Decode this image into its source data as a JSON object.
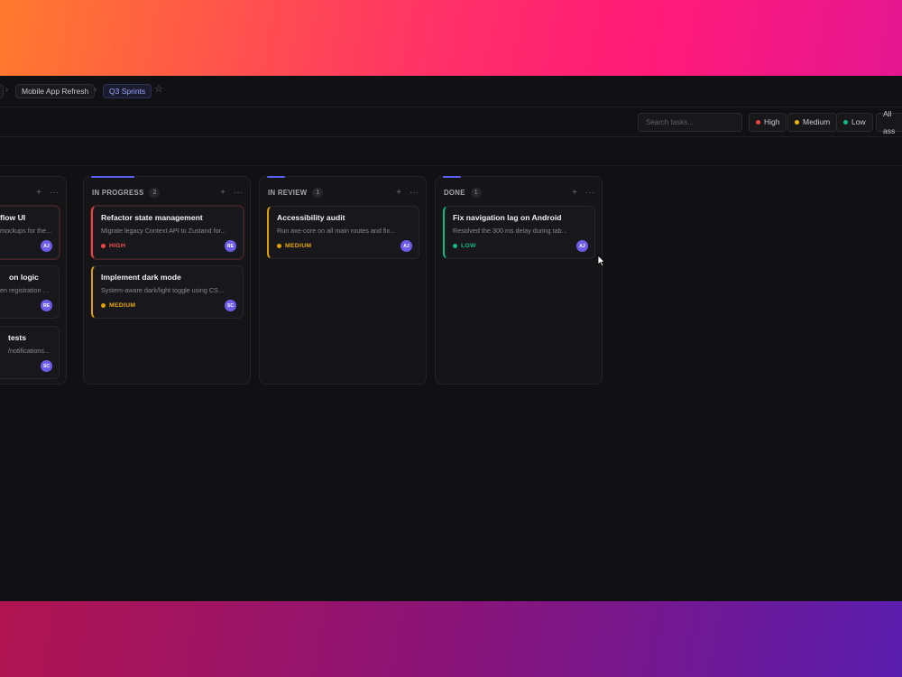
{
  "breadcrumb": {
    "items": [
      {
        "label": "Mobile App Refresh"
      },
      {
        "label": "Q3 Sprints",
        "active": true
      }
    ],
    "separator": "›",
    "star_icon": "star-icon"
  },
  "toolbar": {
    "search_placeholder": "Search tasks...",
    "filters": [
      {
        "label": "High",
        "color": "#ef4444"
      },
      {
        "label": "Medium",
        "color": "#eab308"
      },
      {
        "label": "Low",
        "color": "#10b981"
      }
    ],
    "assignee_label": "All ass"
  },
  "columns": [
    {
      "title": "",
      "count": "",
      "add": "+",
      "more": "···",
      "cards": [
        {
          "title": "flow UI",
          "desc": "mockups for the...",
          "avatar": "AJ",
          "priority": "high"
        },
        {
          "title": "on logic",
          "desc": "en registration on...",
          "avatar": "RE",
          "priority": "none"
        },
        {
          "title": "tests",
          "desc": "/notifications...",
          "avatar": "SC",
          "priority": "none"
        }
      ]
    },
    {
      "title": "IN PROGRESS",
      "count": "2",
      "add": "+",
      "more": "···",
      "cards": [
        {
          "title": "Refactor state management",
          "desc": "Migrate legacy Context API to Zustand for...",
          "priority_label": "HIGH",
          "priority": "high",
          "avatar": "RE"
        },
        {
          "title": "Implement dark mode",
          "desc": "System-aware dark/light toggle using CSS...",
          "priority_label": "MEDIUM",
          "priority": "medium",
          "avatar": "SC"
        }
      ]
    },
    {
      "title": "IN REVIEW",
      "count": "1",
      "add": "+",
      "more": "···",
      "cards": [
        {
          "title": "Accessibility audit",
          "desc": "Run axe-core on all main routes and fix...",
          "priority_label": "MEDIUM",
          "priority": "medium",
          "avatar": "AJ"
        }
      ]
    },
    {
      "title": "DONE",
      "count": "1",
      "add": "+",
      "more": "···",
      "cards": [
        {
          "title": "Fix navigation lag on Android",
          "desc": "Resolved the 300 ms delay during tab...",
          "priority_label": "LOW",
          "priority": "low",
          "avatar": "AJ"
        }
      ]
    }
  ],
  "colors": {
    "accent": "#5b5ff0",
    "high": "#ef4444",
    "medium": "#e0a100",
    "low": "#10b981",
    "avatar": "#6d5ce8"
  }
}
